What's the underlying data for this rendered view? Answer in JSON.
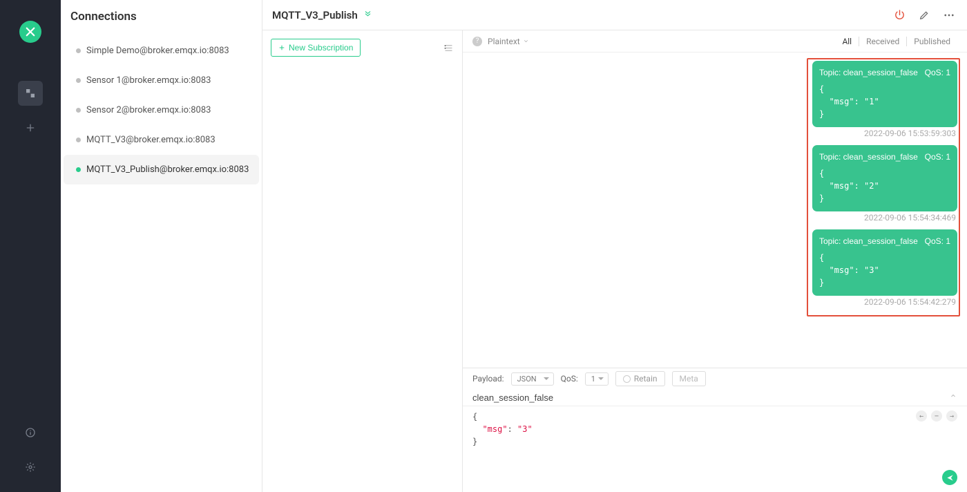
{
  "colors": {
    "accent": "#28cc8c",
    "highlight": "#e34f3a"
  },
  "sidebar": {
    "title": "Connections",
    "items": [
      {
        "label": "Simple Demo@broker.emqx.io:8083",
        "online": false,
        "active": false
      },
      {
        "label": "Sensor 1@broker.emqx.io:8083",
        "online": false,
        "active": false
      },
      {
        "label": "Sensor 2@broker.emqx.io:8083",
        "online": false,
        "active": false
      },
      {
        "label": "MQTT_V3@broker.emqx.io:8083",
        "online": false,
        "active": false
      },
      {
        "label": "MQTT_V3_Publish@broker.emqx.io:8083",
        "online": true,
        "active": true
      }
    ]
  },
  "header": {
    "title": "MQTT_V3_Publish"
  },
  "subscriptions": {
    "new_button": "New Subscription"
  },
  "message_header": {
    "format": "Plaintext",
    "tabs": {
      "all": "All",
      "received": "Received",
      "published": "Published"
    },
    "active_tab": "all"
  },
  "messages": [
    {
      "topic_label": "Topic: clean_session_false",
      "qos_label": "QoS: 1",
      "body": "{\n  \"msg\": \"1\"\n}",
      "time": "2022-09-06 15:53:59:303"
    },
    {
      "topic_label": "Topic: clean_session_false",
      "qos_label": "QoS: 1",
      "body": "{\n  \"msg\": \"2\"\n}",
      "time": "2022-09-06 15:54:34:469"
    },
    {
      "topic_label": "Topic: clean_session_false",
      "qos_label": "QoS: 1",
      "body": "{\n  \"msg\": \"3\"\n}",
      "time": "2022-09-06 15:54:42:279"
    }
  ],
  "publish": {
    "payload_label": "Payload:",
    "payload_format": "JSON",
    "qos_label": "QoS:",
    "qos_value": "1",
    "retain_label": "Retain",
    "meta_label": "Meta",
    "topic_value": "clean_session_false",
    "editor_line1": "{",
    "editor_key": "  \"msg\"",
    "editor_sep": ": ",
    "editor_val": "\"3\"",
    "editor_line3": "}"
  }
}
